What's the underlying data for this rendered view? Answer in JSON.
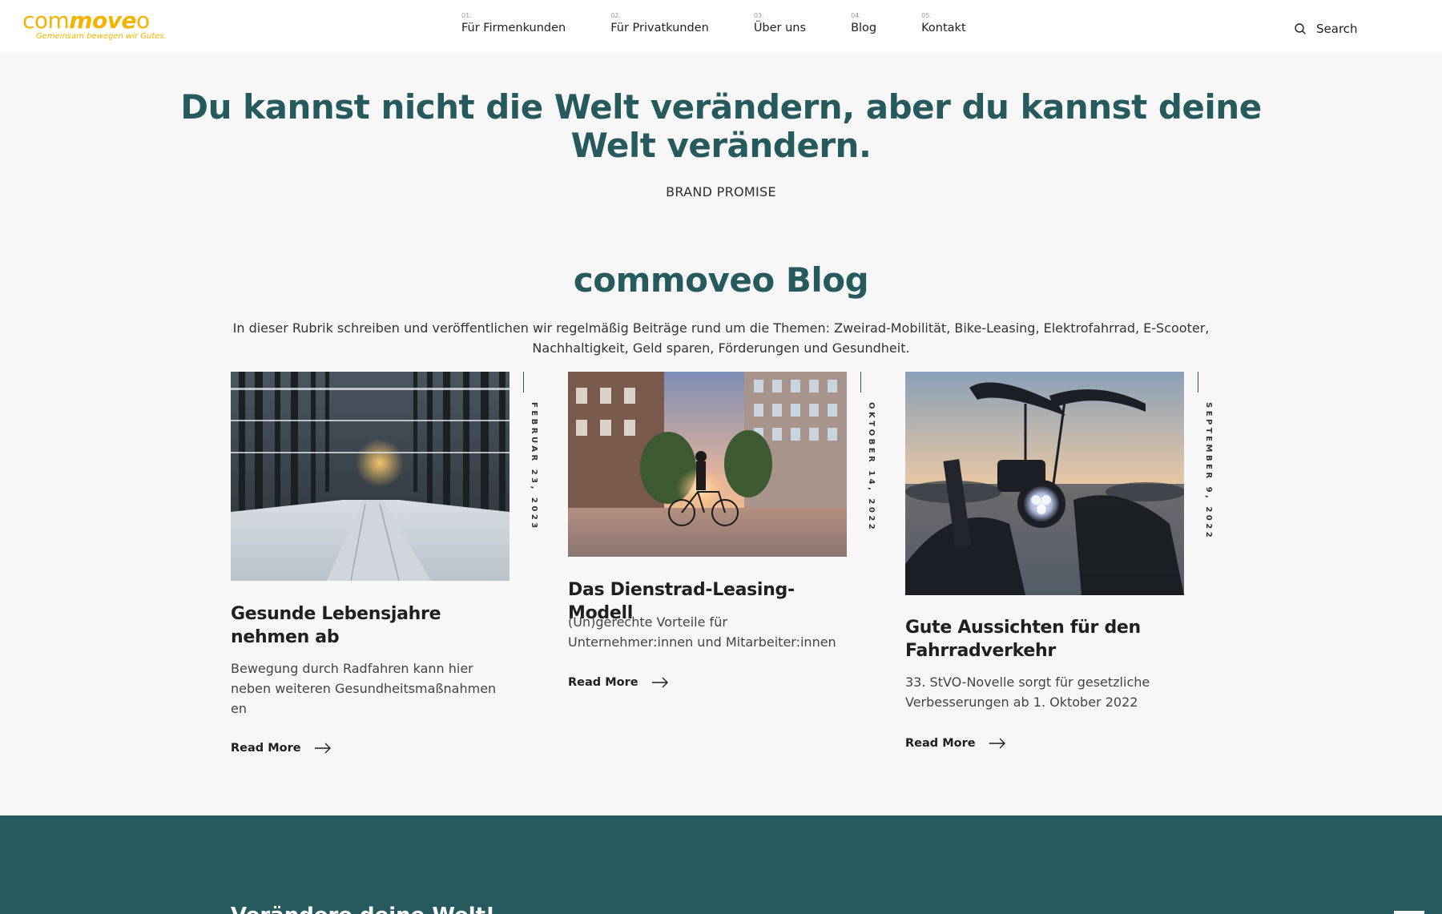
{
  "header": {
    "logo": {
      "word_light": "com",
      "word_bold": "move",
      "word_end": "o",
      "tagline": "Gemeinsam bewegen wir Gutes."
    },
    "nav": [
      {
        "num": "01.",
        "label": "Für Firmenkunden"
      },
      {
        "num": "02.",
        "label": "Für Privatkunden"
      },
      {
        "num": "03.",
        "label": "Über uns"
      },
      {
        "num": "04.",
        "label": "Blog"
      },
      {
        "num": "05.",
        "label": "Kontakt"
      }
    ],
    "search_label": "Search"
  },
  "hero": {
    "title": "Du kannst nicht die Welt verändern, aber du kannst deine Welt verändern.",
    "subtitle": "BRAND PROMISE"
  },
  "blog": {
    "title": "commoveo Blog",
    "intro": "In dieser Rubrik schreiben und veröffentlichen wir regelmäßig Beiträge rund um die Themen: Zweirad-Mobilität, Bike-Leasing, Elektrofahrrad, E-Scooter, Nachhaltigkeit, Geld sparen, Förderungen und Gesundheit.",
    "read_more": "Read More",
    "posts": [
      {
        "date": "FEBRUAR 23, 2023",
        "title": "Gesunde Lebensjahre nehmen ab",
        "excerpt": "Bewegung durch Radfahren kann hier neben weiteren Gesundheitsmaßnahmen en",
        "image": "snowy-forest-road"
      },
      {
        "date": "OKTOBER 14, 2022",
        "title": "Das Dienstrad-Leasing-Modell",
        "excerpt": "(Un)gerechte Vorteile für Unternehmer:innen und Mitarbeiter:innen",
        "image": "cyclist-city-sunset"
      },
      {
        "date": "SEPTEMBER 9, 2022",
        "title": "Gute Aussichten für den Fahrradverkehr",
        "excerpt": "33. StVO-Novelle sorgt für gesetzliche Verbesserungen ab 1. Oktober 2022",
        "image": "ebike-headlight"
      }
    ]
  },
  "footer": {
    "heading": "Verändere deine Welt!"
  },
  "colors": {
    "brand_teal": "#265a5e",
    "logo_yellow": "#f5b300",
    "background": "#f7f7f7"
  }
}
